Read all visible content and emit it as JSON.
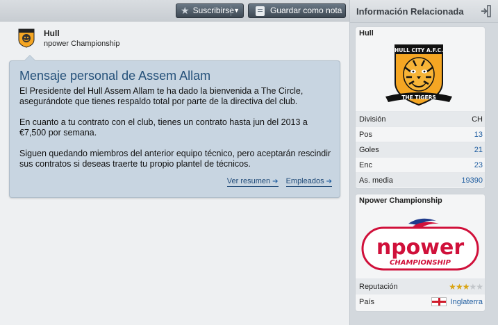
{
  "toolbar": {
    "subscribe_label": "Suscribirse",
    "save_note_label": "Guardar como nota"
  },
  "club_header": {
    "name": "Hull",
    "league": "npower Championship"
  },
  "message": {
    "title": "Mensaje personal de Assem Allam",
    "paragraphs": [
      "El Presidente del Hull Assem Allam te ha dado la bienvenida a The Circle, asegurándote que tienes respaldo total por parte de la directiva del club.",
      "En cuanto a tu contrato con el club, tienes un contrato hasta jun del 2013 a €7,500 por semana.",
      "Siguen quedando miembros del anterior equipo técnico, pero aceptarán rescindir sus contratos si deseas traerte tu propio plantel de técnicos."
    ],
    "links": {
      "summary": "Ver resumen",
      "staff": "Empleados"
    }
  },
  "sidebar": {
    "title": "Información Relacionada",
    "club_card": {
      "title": "Hull",
      "crest_text_top": "HULL CITY A.F.C.",
      "crest_text_bottom": "THE TIGERS",
      "rows": [
        {
          "label": "División",
          "value": "CH"
        },
        {
          "label": "Pos",
          "value": "13"
        },
        {
          "label": "Goles",
          "value": "21"
        },
        {
          "label": "Enc",
          "value": "23"
        },
        {
          "label": "As. media",
          "value": "19390"
        }
      ]
    },
    "league_card": {
      "title": "Npower Championship",
      "logo_text": "npower",
      "logo_sub": "CHAMPIONSHIP",
      "reputation_label": "Reputación",
      "reputation_stars": 3,
      "reputation_max": 5,
      "country_label": "País",
      "country_value": "Inglaterra"
    }
  },
  "colors": {
    "message_bg": "#c8d5e1",
    "title_blue": "#25517a",
    "link_blue": "#1f5da0",
    "crest_orange": "#f5a623",
    "npower_red": "#d0103a"
  }
}
